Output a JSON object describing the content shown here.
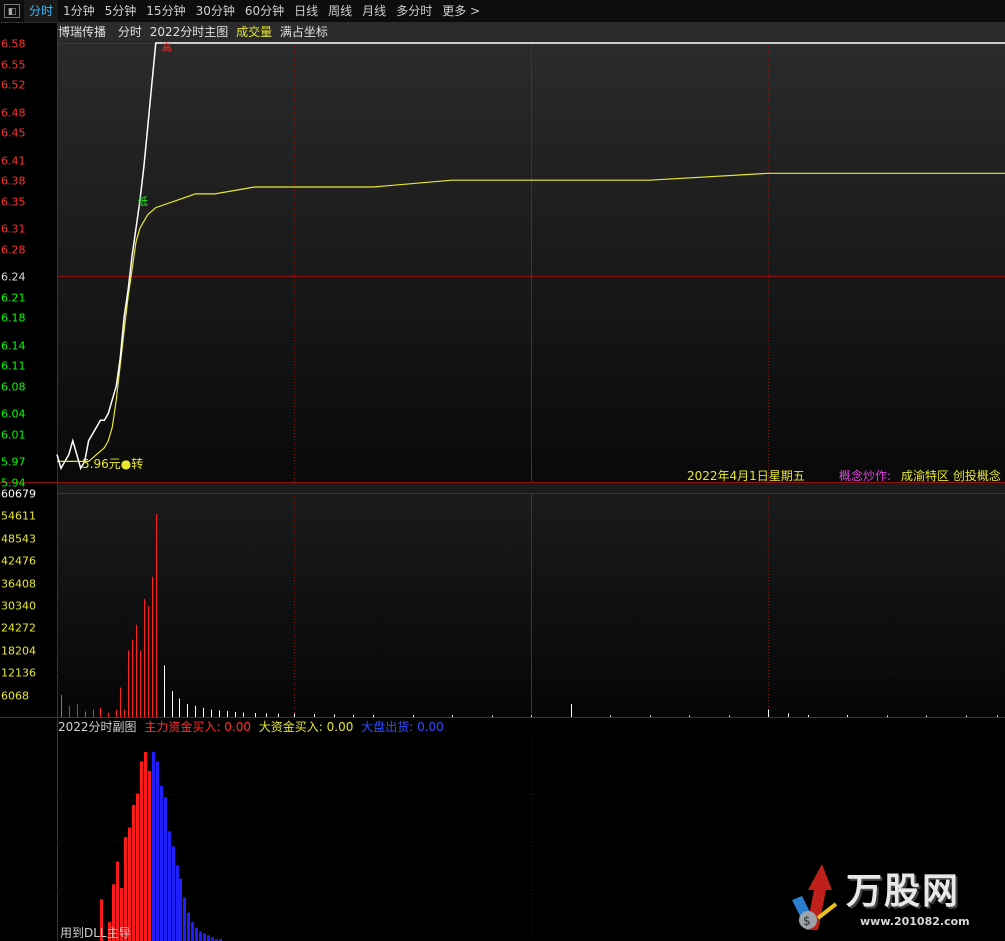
{
  "tabs": [
    "分时",
    "1分钟",
    "5分钟",
    "15分钟",
    "30分钟",
    "60分钟",
    "日线",
    "周线",
    "月线",
    "多分时",
    "更多 >"
  ],
  "active_tab": 0,
  "header": {
    "stock_name": "博瑞传播",
    "mode": "分时",
    "main_indicator": "2022分时主图",
    "volume_label": "成交量",
    "scale_label": "满占坐标"
  },
  "price_axis": {
    "ticks": [
      "6.58",
      "6.55",
      "6.52",
      "6.48",
      "6.45",
      "6.41",
      "6.38",
      "6.35",
      "6.31",
      "6.28",
      "6.24",
      "6.21",
      "6.18",
      "6.14",
      "6.11",
      "6.08",
      "6.04",
      "6.01",
      "5.97",
      "5.94"
    ],
    "tick_values": [
      6.58,
      6.55,
      6.52,
      6.48,
      6.45,
      6.41,
      6.38,
      6.35,
      6.31,
      6.28,
      6.24,
      6.21,
      6.18,
      6.14,
      6.11,
      6.08,
      6.04,
      6.01,
      5.97,
      5.94
    ],
    "min": 5.94,
    "max": 6.58,
    "base": 6.24,
    "up_color": "#ff3030",
    "down_color": "#00ff00"
  },
  "volume_axis": {
    "ticks": [
      "60679",
      "54611",
      "48543",
      "42476",
      "36408",
      "30340",
      "24272",
      "18204",
      "12136",
      "6068"
    ],
    "max": 60679
  },
  "price_marker": "5.96元●转",
  "marker_low": "低",
  "marker_high": "高",
  "date_text": "2022年4月1日星期五",
  "concept_label": "概念炒作:",
  "concept_value": "成渝特区 创投概念",
  "sub_chart": {
    "title": "2022分时副图",
    "main_buy_label": "主力资金买入:",
    "main_buy_value": "0.00",
    "big_buy_label": "大资金买入:",
    "big_buy_value": "0.00",
    "outflow_label": "大盘出货:",
    "outflow_value": "0.00",
    "footer_text": "用到DLL主导"
  },
  "watermark": {
    "brand": "万股网",
    "site": "www.201082.com"
  },
  "colors": {
    "grid_red": "#8a1414",
    "price_line": "#ffffff",
    "avg_line": "#e8e830",
    "vol_up": "#ff2020",
    "vol_down": "#00cc00",
    "vol_flat": "#ffffff",
    "fund_red": "#ff1a1a",
    "fund_blue": "#1f1fff"
  },
  "chart_data": {
    "type": "line",
    "price_series": {
      "name": "",
      "points": [
        [
          0,
          5.98
        ],
        [
          1,
          5.96
        ],
        [
          2,
          5.97
        ],
        [
          3,
          5.98
        ],
        [
          4,
          6.0
        ],
        [
          5,
          5.98
        ],
        [
          6,
          5.96
        ],
        [
          7,
          5.97
        ],
        [
          8,
          6.0
        ],
        [
          9,
          6.01
        ],
        [
          10,
          6.02
        ],
        [
          11,
          6.03
        ],
        [
          12,
          6.03
        ],
        [
          13,
          6.04
        ],
        [
          14,
          6.06
        ],
        [
          15,
          6.08
        ],
        [
          16,
          6.12
        ],
        [
          17,
          6.18
        ],
        [
          18,
          6.22
        ],
        [
          19,
          6.27
        ],
        [
          20,
          6.31
        ],
        [
          21,
          6.35
        ],
        [
          22,
          6.4
        ],
        [
          23,
          6.46
        ],
        [
          24,
          6.52
        ],
        [
          25,
          6.58
        ],
        [
          240,
          6.58
        ]
      ]
    },
    "avg_series": {
      "name": "",
      "points": [
        [
          0,
          5.97
        ],
        [
          4,
          5.97
        ],
        [
          8,
          5.97
        ],
        [
          10,
          5.98
        ],
        [
          12,
          5.99
        ],
        [
          13,
          6.0
        ],
        [
          14,
          6.02
        ],
        [
          15,
          6.06
        ],
        [
          16,
          6.11
        ],
        [
          17,
          6.16
        ],
        [
          18,
          6.21
        ],
        [
          19,
          6.25
        ],
        [
          20,
          6.29
        ],
        [
          21,
          6.31
        ],
        [
          22,
          6.32
        ],
        [
          23,
          6.33
        ],
        [
          25,
          6.34
        ],
        [
          30,
          6.35
        ],
        [
          35,
          6.36
        ],
        [
          40,
          6.36
        ],
        [
          50,
          6.37
        ],
        [
          60,
          6.37
        ],
        [
          80,
          6.37
        ],
        [
          100,
          6.38
        ],
        [
          120,
          6.38
        ],
        [
          150,
          6.38
        ],
        [
          180,
          6.39
        ],
        [
          210,
          6.39
        ],
        [
          240,
          6.39
        ]
      ]
    },
    "volume": [
      {
        "t": 1,
        "v": 6000,
        "d": "down"
      },
      {
        "t": 3,
        "v": 3000,
        "d": "up"
      },
      {
        "t": 5,
        "v": 3500,
        "d": "up"
      },
      {
        "t": 7,
        "v": 1500,
        "d": "down"
      },
      {
        "t": 9,
        "v": 2000,
        "d": "up"
      },
      {
        "t": 11,
        "v": 2500,
        "d": "up"
      },
      {
        "t": 13,
        "v": 1200,
        "d": "up"
      },
      {
        "t": 15,
        "v": 2000,
        "d": "up"
      },
      {
        "t": 16,
        "v": 8000,
        "d": "up"
      },
      {
        "t": 17,
        "v": 2000,
        "d": "up"
      },
      {
        "t": 18,
        "v": 18000,
        "d": "up"
      },
      {
        "t": 19,
        "v": 21000,
        "d": "up"
      },
      {
        "t": 20,
        "v": 25000,
        "d": "up"
      },
      {
        "t": 21,
        "v": 18000,
        "d": "up"
      },
      {
        "t": 22,
        "v": 32000,
        "d": "up"
      },
      {
        "t": 23,
        "v": 30000,
        "d": "up"
      },
      {
        "t": 24,
        "v": 38000,
        "d": "up"
      },
      {
        "t": 25,
        "v": 55000,
        "d": "up"
      },
      {
        "t": 27,
        "v": 14000,
        "d": "flat"
      },
      {
        "t": 29,
        "v": 7000,
        "d": "flat"
      },
      {
        "t": 31,
        "v": 5000,
        "d": "flat"
      },
      {
        "t": 33,
        "v": 3500,
        "d": "flat"
      },
      {
        "t": 35,
        "v": 3000,
        "d": "flat"
      },
      {
        "t": 37,
        "v": 2500,
        "d": "flat"
      },
      {
        "t": 39,
        "v": 2000,
        "d": "flat"
      },
      {
        "t": 41,
        "v": 1800,
        "d": "flat"
      },
      {
        "t": 43,
        "v": 1600,
        "d": "flat"
      },
      {
        "t": 45,
        "v": 1400,
        "d": "flat"
      },
      {
        "t": 47,
        "v": 1200,
        "d": "flat"
      },
      {
        "t": 50,
        "v": 1100,
        "d": "flat"
      },
      {
        "t": 53,
        "v": 1000,
        "d": "flat"
      },
      {
        "t": 56,
        "v": 900,
        "d": "flat"
      },
      {
        "t": 60,
        "v": 900,
        "d": "flat"
      },
      {
        "t": 65,
        "v": 800,
        "d": "flat"
      },
      {
        "t": 70,
        "v": 700,
        "d": "flat"
      },
      {
        "t": 75,
        "v": 600,
        "d": "flat"
      },
      {
        "t": 80,
        "v": 600,
        "d": "flat"
      },
      {
        "t": 90,
        "v": 500,
        "d": "flat"
      },
      {
        "t": 100,
        "v": 500,
        "d": "flat"
      },
      {
        "t": 110,
        "v": 400,
        "d": "flat"
      },
      {
        "t": 120,
        "v": 400,
        "d": "flat"
      },
      {
        "t": 130,
        "v": 3500,
        "d": "flat"
      },
      {
        "t": 140,
        "v": 400,
        "d": "flat"
      },
      {
        "t": 150,
        "v": 400,
        "d": "flat"
      },
      {
        "t": 160,
        "v": 400,
        "d": "flat"
      },
      {
        "t": 170,
        "v": 400,
        "d": "flat"
      },
      {
        "t": 180,
        "v": 2000,
        "d": "flat"
      },
      {
        "t": 185,
        "v": 1000,
        "d": "flat"
      },
      {
        "t": 190,
        "v": 500,
        "d": "flat"
      },
      {
        "t": 200,
        "v": 500,
        "d": "flat"
      },
      {
        "t": 210,
        "v": 400,
        "d": "flat"
      },
      {
        "t": 220,
        "v": 400,
        "d": "flat"
      },
      {
        "t": 230,
        "v": 400,
        "d": "flat"
      },
      {
        "t": 238,
        "v": 400,
        "d": "flat"
      }
    ],
    "fund_bars": [
      {
        "t": 11,
        "v": 0.22,
        "c": "red"
      },
      {
        "t": 13,
        "v": 0.1,
        "c": "red"
      },
      {
        "t": 14,
        "v": 0.3,
        "c": "red"
      },
      {
        "t": 15,
        "v": 0.42,
        "c": "red"
      },
      {
        "t": 16,
        "v": 0.28,
        "c": "red"
      },
      {
        "t": 17,
        "v": 0.55,
        "c": "red"
      },
      {
        "t": 18,
        "v": 0.6,
        "c": "red"
      },
      {
        "t": 19,
        "v": 0.72,
        "c": "red"
      },
      {
        "t": 20,
        "v": 0.78,
        "c": "red"
      },
      {
        "t": 21,
        "v": 0.95,
        "c": "red"
      },
      {
        "t": 22,
        "v": 1.0,
        "c": "red"
      },
      {
        "t": 23,
        "v": 0.9,
        "c": "red"
      },
      {
        "t": 24,
        "v": 1.0,
        "c": "blue"
      },
      {
        "t": 25,
        "v": 0.95,
        "c": "blue"
      },
      {
        "t": 26,
        "v": 0.82,
        "c": "blue"
      },
      {
        "t": 27,
        "v": 0.76,
        "c": "blue"
      },
      {
        "t": 28,
        "v": 0.58,
        "c": "blue"
      },
      {
        "t": 29,
        "v": 0.5,
        "c": "blue"
      },
      {
        "t": 30,
        "v": 0.4,
        "c": "blue"
      },
      {
        "t": 31,
        "v": 0.33,
        "c": "blue"
      },
      {
        "t": 32,
        "v": 0.23,
        "c": "blue"
      },
      {
        "t": 33,
        "v": 0.15,
        "c": "blue"
      },
      {
        "t": 34,
        "v": 0.1,
        "c": "blue"
      },
      {
        "t": 35,
        "v": 0.07,
        "c": "blue"
      },
      {
        "t": 36,
        "v": 0.05,
        "c": "blue"
      },
      {
        "t": 37,
        "v": 0.04,
        "c": "blue"
      },
      {
        "t": 38,
        "v": 0.03,
        "c": "blue"
      },
      {
        "t": 39,
        "v": 0.02,
        "c": "blue"
      },
      {
        "t": 40,
        "v": 0.01,
        "c": "blue"
      },
      {
        "t": 41,
        "v": 0.01,
        "c": "blue"
      }
    ],
    "x_range": [
      0,
      240
    ],
    "ylim": [
      5.94,
      6.58
    ],
    "grid": true,
    "legend": ""
  }
}
